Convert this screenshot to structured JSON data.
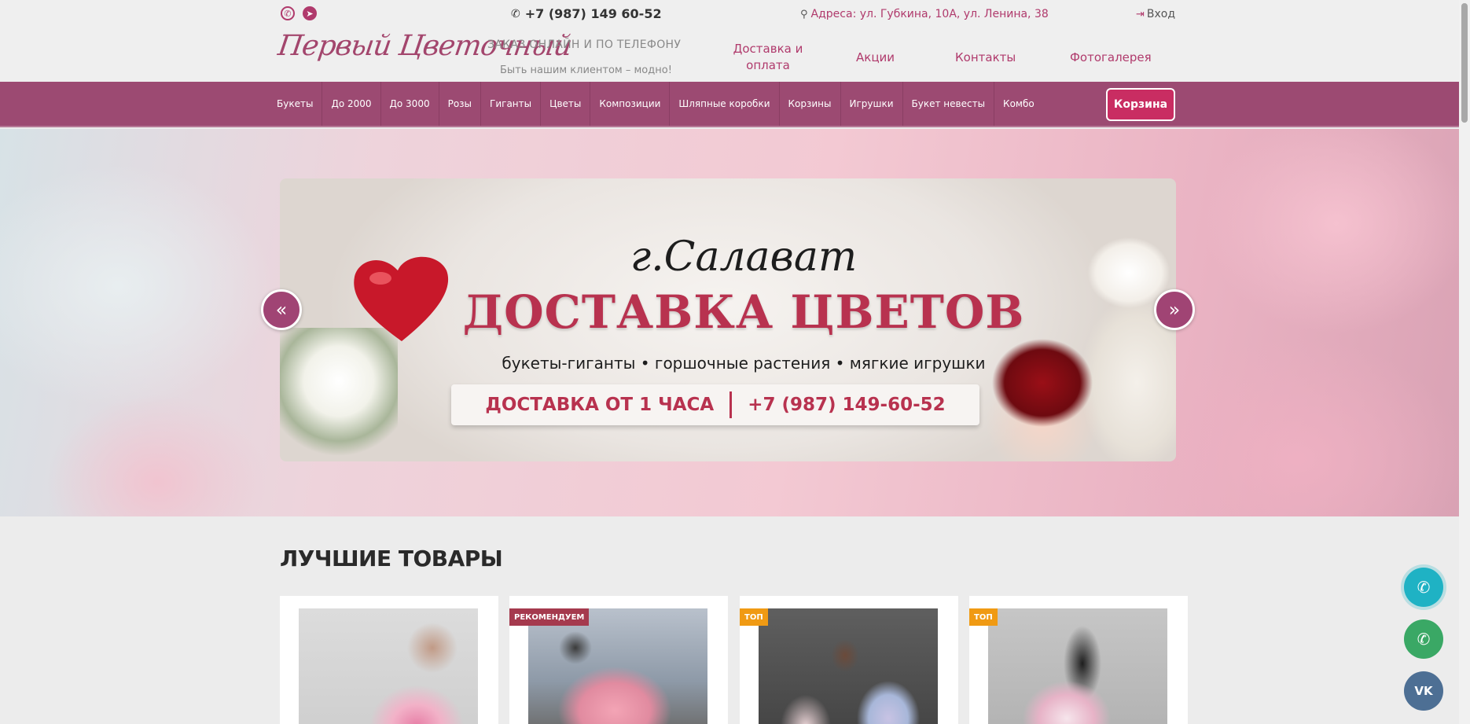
{
  "header": {
    "phone": "+7 (987) 149 60-52",
    "address": "Адреса: ул. Губкина, 10А, ул. Ленина, 38",
    "login": "Вход",
    "logo": "Первый Цветочный",
    "tagline": "ЗАКАЗ ОНЛАЙН И ПО ТЕЛЕФОНУ",
    "slogan": "Быть нашим клиентом – модно!",
    "nav": [
      {
        "label_line1": "Доставка и",
        "label_line2": "оплата"
      },
      {
        "label": "Акции"
      },
      {
        "label": "Контакты"
      },
      {
        "label": "Фотогалерея"
      }
    ]
  },
  "menu": {
    "items": [
      "Букеты",
      "До 2000",
      "До 3000",
      "Розы",
      "Гиганты",
      "Цветы",
      "Композиции",
      "Шляпные коробки",
      "Корзины",
      "Игрушки",
      "Букет невесты",
      "Комбо"
    ],
    "cart": "Корзина"
  },
  "banner": {
    "city": "г.Салават",
    "headline": "ДОСТАВКА ЦВЕТОВ",
    "subline": "букеты-гиганты  •  горшочные растения  •  мягкие игрушки",
    "delivery": "ДОСТАВКА ОТ 1 ЧАСА",
    "phone": "+7 (987) 149-60-52",
    "prev_icon": "«",
    "next_icon": "»"
  },
  "products": {
    "title": "ЛУЧШИЕ ТОВАРЫ",
    "cards": [
      {
        "badge": ""
      },
      {
        "badge": "РЕКОМЕНДУЕМ"
      },
      {
        "badge": "ТОП"
      },
      {
        "badge": "ТОП"
      }
    ]
  },
  "floating": {
    "vk": "VK"
  },
  "colors": {
    "accent": "#b03a6c",
    "menu_bg": "#9c4a72",
    "cart_bg": "#c92d62",
    "badge_top": "#f09a13",
    "badge_recommend": "#a53a4e"
  }
}
